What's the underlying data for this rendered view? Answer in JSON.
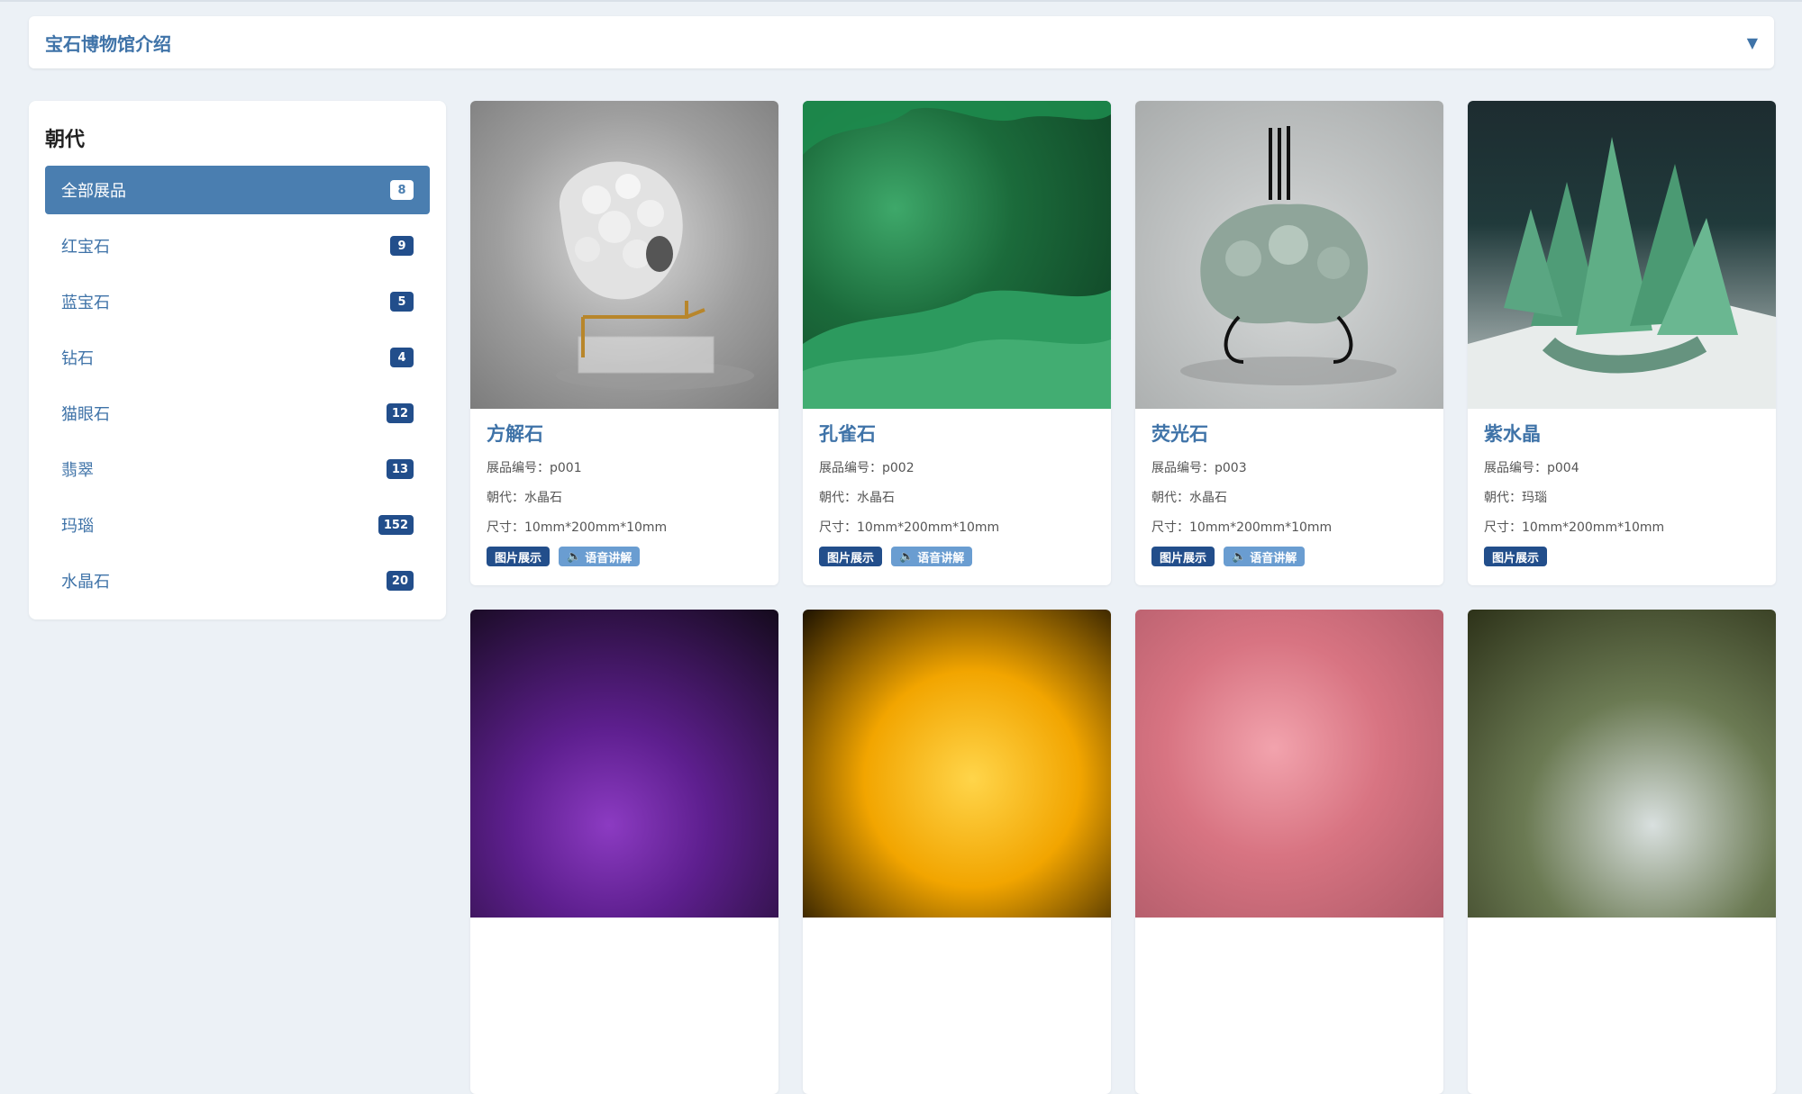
{
  "accordion": {
    "title": "宝石博物馆介绍",
    "caret": "▼"
  },
  "sidebar": {
    "heading": "朝代",
    "items": [
      {
        "label": "全部展品",
        "count": "8"
      },
      {
        "label": "红宝石",
        "count": "9"
      },
      {
        "label": "蓝宝石",
        "count": "5"
      },
      {
        "label": "钻石",
        "count": "4"
      },
      {
        "label": "猫眼石",
        "count": "12"
      },
      {
        "label": "翡翠",
        "count": "13"
      },
      {
        "label": "玛瑙",
        "count": "152"
      },
      {
        "label": "水晶石",
        "count": "20"
      }
    ]
  },
  "cards": [
    {
      "name": "方解石",
      "id_label": "展品编号：p001",
      "dynasty_label": "朝代：水晶石",
      "size_label": "尺寸：10mm*200mm*10mm",
      "btn_images": "图片展示",
      "btn_audio": "语音讲解"
    },
    {
      "name": "孔雀石",
      "id_label": "展品编号：p002",
      "dynasty_label": "朝代：水晶石",
      "size_label": "尺寸：10mm*200mm*10mm",
      "btn_images": "图片展示",
      "btn_audio": "语音讲解"
    },
    {
      "name": "荧光石",
      "id_label": "展品编号：p003",
      "dynasty_label": "朝代：水晶石",
      "size_label": "尺寸：10mm*200mm*10mm",
      "btn_images": "图片展示",
      "btn_audio": "语音讲解"
    },
    {
      "name": "紫水晶",
      "id_label": "展品编号：p004",
      "dynasty_label": "朝代：玛瑙",
      "size_label": "尺寸：10mm*200mm*10mm",
      "btn_images": "图片展示"
    }
  ],
  "icons": {
    "audio": "speaker-icon",
    "caret": "chevron-down-icon"
  },
  "colors": {
    "primary": "#224e8b",
    "accent": "#4a7eb0",
    "title": "#3f73a8",
    "secondary": "#6a9dd1"
  }
}
